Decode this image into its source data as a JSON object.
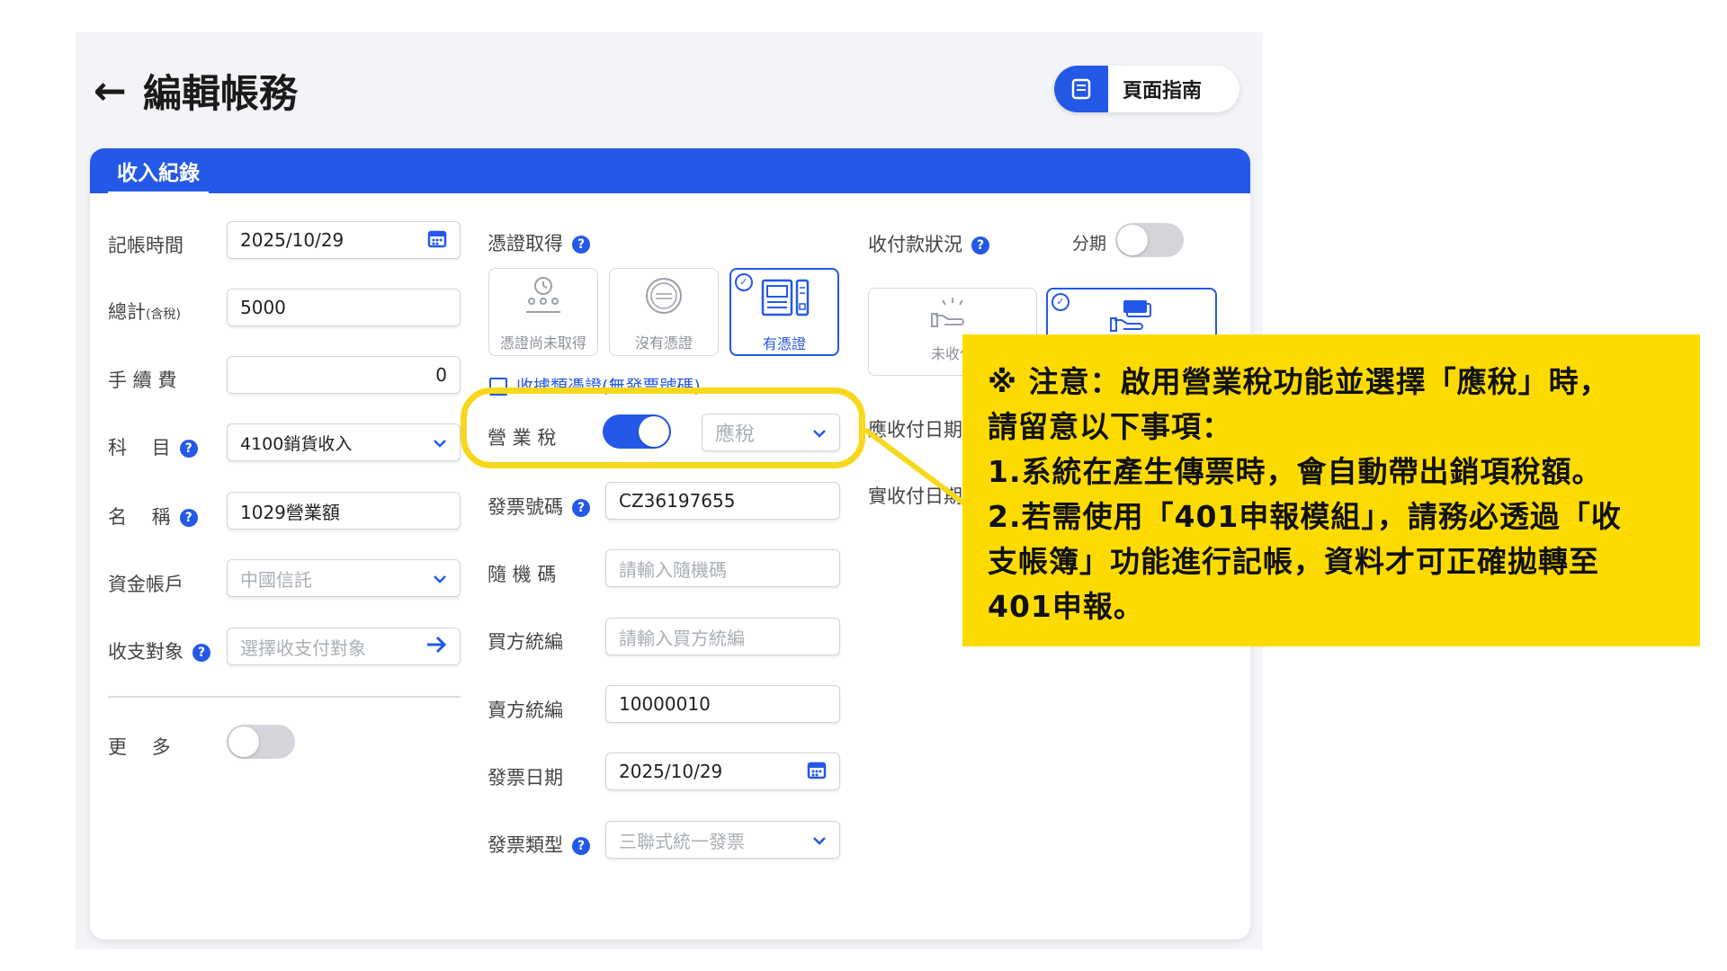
{
  "header": {
    "back_icon": "←",
    "title": "編輯帳務",
    "guide_icon": "book-icon",
    "guide_label": "頁面指南"
  },
  "tab": {
    "label": "收入紀錄"
  },
  "left": {
    "date_label": "記帳時間",
    "date_value": "2025/10/29",
    "total_label": "總計",
    "total_sub": "(含稅)",
    "total_value": "5000",
    "fee_label": "手 續 費",
    "fee_value": "0",
    "subject_label": "科　 目",
    "subject_value": "4100銷貨收入",
    "name_label": "名　 稱",
    "name_value": "1029營業額",
    "account_label": "資金帳戶",
    "account_value": "中國信託",
    "payee_label": "收支對象",
    "payee_placeholder": "選擇收支付對象",
    "more_label": "更　 多"
  },
  "middle": {
    "voucher_label": "憑證取得",
    "vouchers": [
      {
        "label": "憑證尚未取得"
      },
      {
        "label": "沒有憑證"
      },
      {
        "label": "有憑證"
      }
    ],
    "receipt_checkbox_label": "收據類憑證(無發票號碼)",
    "tax_label": "營 業 稅",
    "tax_value": "應稅",
    "invoice_no_label": "發票號碼",
    "invoice_no_value": "CZ36197655",
    "random_label": "隨 機 碼",
    "random_placeholder": "請輸入隨機碼",
    "buyer_label": "買方統編",
    "buyer_placeholder": "請輸入買方統編",
    "seller_label": "賣方統編",
    "seller_value": "10000010",
    "invoice_date_label": "發票日期",
    "invoice_date_value": "2025/10/29",
    "invoice_type_label": "發票類型",
    "invoice_type_value": "三聯式統一發票"
  },
  "right": {
    "payment_label": "收付款狀況",
    "installment_label": "分期",
    "pay_options": [
      {
        "label": "未收付"
      }
    ],
    "due_label": "應收付日期",
    "actual_label": "實收付日期"
  },
  "note": {
    "line1": "※ 注意：啟用營業稅功能並選擇「應稅」時，",
    "line2": "請留意以下事項：",
    "line3": "1.系統在產生傳票時，會自動帶出銷項稅額。",
    "line4": "2.若需使用「401申報模組」，請務必透過「收",
    "line5": "支帳簿」功能進行記帳，資料才可正確拋轉至",
    "line6": "401申報。"
  },
  "colors": {
    "accent": "#2458e6",
    "note_bg": "#fddb00",
    "highlight": "#f7d81c"
  }
}
